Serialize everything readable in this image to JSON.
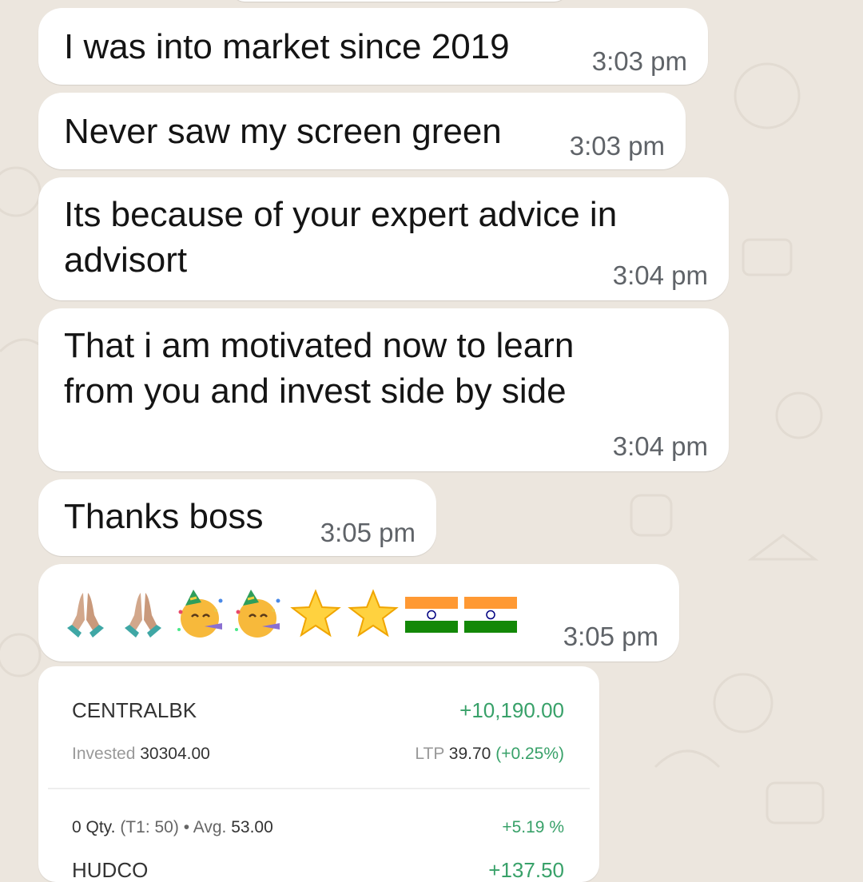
{
  "colors": {
    "background": "#ece6de",
    "bubble": "#ffffff",
    "text": "#141414",
    "timestamp": "#5f6368",
    "profit_green": "#38a169"
  },
  "messages": [
    {
      "text": "I was into market since 2019",
      "time": "3:03 pm"
    },
    {
      "text": "Never saw my screen green",
      "time": "3:03 pm"
    },
    {
      "lines": [
        "Its because of your expert advice in",
        "advisort"
      ],
      "time": "3:04 pm"
    },
    {
      "lines": [
        "That i am motivated now to learn",
        "from you and invest side by side"
      ],
      "time": "3:04 pm"
    },
    {
      "text": "Thanks boss",
      "time": "3:05 pm"
    },
    {
      "emojis": [
        "folded-hands-icon",
        "folded-hands-icon",
        "partying-face-icon",
        "partying-face-icon",
        "star-icon",
        "star-icon",
        "india-flag-icon",
        "india-flag-icon"
      ],
      "time": "3:05 pm"
    }
  ],
  "portfolio_image": {
    "holding1": {
      "symbol": "CENTRALBK",
      "pnl": "+10,190.00",
      "invested_label": "Invested",
      "invested_value": "30304.00",
      "ltp_label": "LTP",
      "ltp_value": "39.70",
      "ltp_change": "(+0.25%)"
    },
    "holding2": {
      "qty": "0 Qty.",
      "t1": "(T1: 50)",
      "bullet": "•",
      "avg_label": "Avg.",
      "avg_value": "53.00",
      "pct": "+5.19 %",
      "symbol_partial": "HUDCO",
      "pnl_partial": "+137.50"
    }
  }
}
